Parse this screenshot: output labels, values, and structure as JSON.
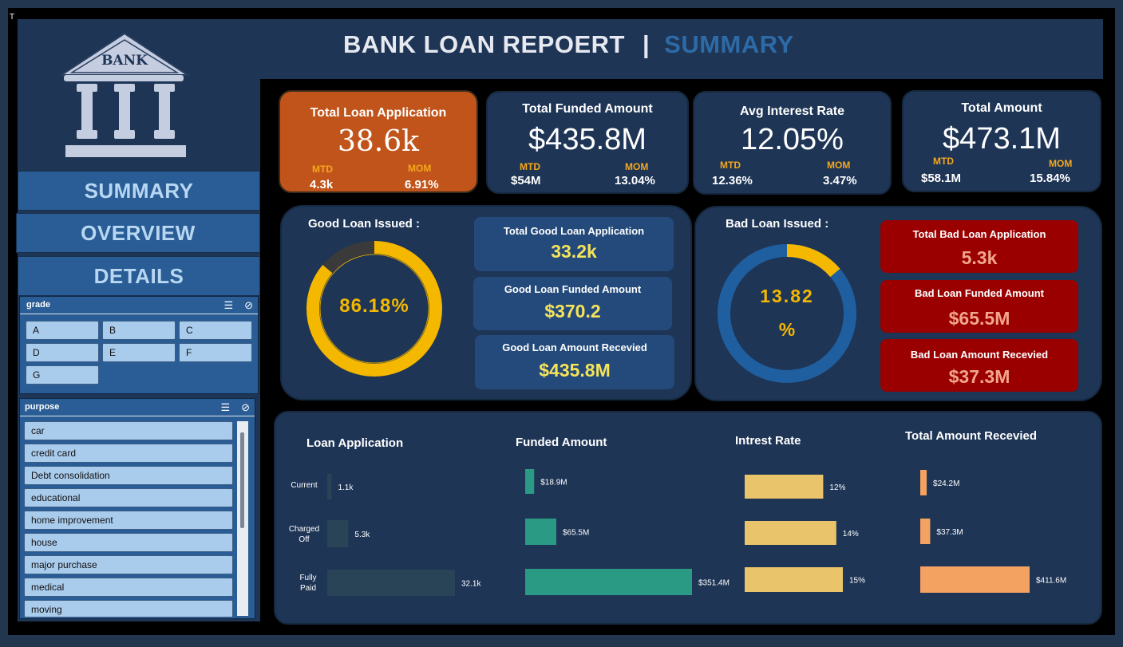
{
  "corner_mark": "T",
  "header": {
    "title": "BANK LOAN REPOERT",
    "separator": "|",
    "subtitle": "SUMMARY"
  },
  "logo": {
    "text": "BANK"
  },
  "nav": {
    "summary": "SUMMARY",
    "overview": "OVERVIEW",
    "details": "DETAILS"
  },
  "slicers": {
    "grade": {
      "title": "grade",
      "items": [
        "A",
        "B",
        "C",
        "D",
        "E",
        "F",
        "G"
      ]
    },
    "purpose": {
      "title": "purpose",
      "items": [
        "car",
        "credit card",
        "Debt consolidation",
        "educational",
        "home improvement",
        "house",
        "major purchase",
        "medical",
        "moving"
      ]
    }
  },
  "kpis": {
    "total_loan_application": {
      "title": "Total  Loan  Application",
      "value": "38.6k",
      "mtd_label": "MTD",
      "mtd": "4.3k",
      "mom_label": "MOM",
      "mom": "6.91%"
    },
    "total_funded_amount": {
      "title": "Total Funded Amount",
      "value": "$435.8M",
      "mtd_label": "MTD",
      "mtd": "$54M",
      "mom_label": "MOM",
      "mom": "13.04%"
    },
    "avg_interest_rate": {
      "title": "Avg Interest Rate",
      "value": "12.05%",
      "mtd_label": "MTD",
      "mtd": "12.36%",
      "mom_label": "MOM",
      "mom": "3.47%"
    },
    "total_amount": {
      "title": "Total  Amount",
      "value": "$473.1M",
      "mtd_label": "MTD",
      "mtd": "$58.1M",
      "mom_label": "MOM",
      "mom": "15.84%"
    }
  },
  "good_loan": {
    "title": "Good Loan Issued :",
    "percent_label": "86.18%",
    "percent": 86.18,
    "application_title": "Total  Good Loan  Application",
    "application_value": "33.2k",
    "funded_title": "Good Loan Funded Amount",
    "funded_value": "$370.2",
    "received_title": "Good Loan Amount Recevied",
    "received_value": "$435.8M"
  },
  "bad_loan": {
    "title": "Bad  Loan Issued :",
    "percent_line1": "13.82",
    "percent_line2": "%",
    "percent": 13.82,
    "application_title": "Total  Bad Loan  Application",
    "application_value": "5.3k",
    "funded_title": "Bad Loan Funded Amount",
    "funded_value": "$65.5M",
    "received_title": "Bad Loan Amount Recevied",
    "received_value": "$37.3M"
  },
  "colors": {
    "good_ring": "#f5b800",
    "good_track": "#3a3a3a",
    "bad_ring": "#1f5fa0",
    "bad_arc": "#f5b800"
  },
  "chart_data": [
    {
      "type": "bar",
      "title": "Loan  Application",
      "categories": [
        "Current",
        "Charged Off",
        "Fully Paid"
      ],
      "values": [
        1.1,
        5.3,
        32.1
      ],
      "labels": [
        "1.1k",
        "5.3k",
        "32.1k"
      ],
      "color": "#284456"
    },
    {
      "type": "bar",
      "title": "Funded Amount",
      "categories": [
        "Current",
        "Charged Off",
        "Fully Paid"
      ],
      "values": [
        18.9,
        65.5,
        351.4
      ],
      "labels": [
        "$18.9M",
        "$65.5M",
        "$351.4M"
      ],
      "color": "#2a9a85"
    },
    {
      "type": "bar",
      "title": "Intrest Rate",
      "categories": [
        "Current",
        "Charged Off",
        "Fully Paid"
      ],
      "values": [
        12,
        14,
        15
      ],
      "labels": [
        "12%",
        "14%",
        "15%"
      ],
      "color": "#e9c46a"
    },
    {
      "type": "bar",
      "title": "Total  Amount Recevied",
      "categories": [
        "Current",
        "Charged Off",
        "Fully Paid"
      ],
      "values": [
        24.2,
        37.3,
        411.6
      ],
      "labels": [
        "$24.2M",
        "$37.3M",
        "$411.6M"
      ],
      "color": "#f4a261"
    }
  ],
  "category_labels": [
    [
      "Current"
    ],
    [
      "Charged",
      "Off"
    ],
    [
      "Fully",
      "Paid"
    ]
  ]
}
